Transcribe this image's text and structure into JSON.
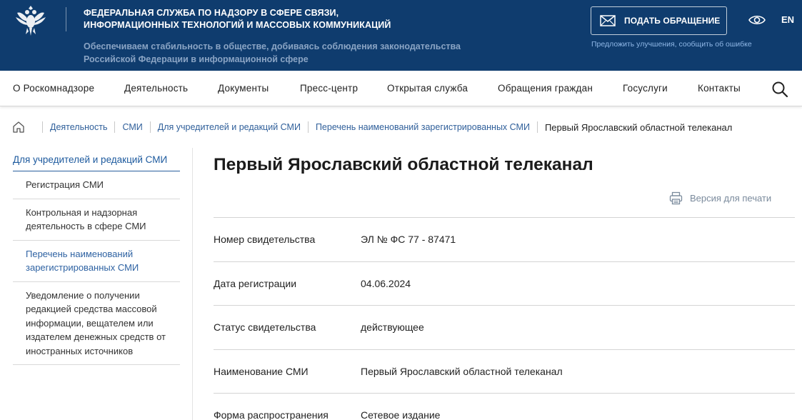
{
  "header": {
    "agency_line1": "ФЕДЕРАЛЬНАЯ СЛУЖБА ПО НАДЗОРУ В СФЕРЕ СВЯЗИ,",
    "agency_line2": "ИНФОРМАЦИОННЫХ ТЕХНОЛОГИЙ И МАССОВЫХ КОММУНИКАЦИЙ",
    "tagline_line1": "Обеспечиваем стабильность в обществе, добиваясь соблюдения законодательства",
    "tagline_line2": "Российской Федерации в информационной сфере",
    "appeal_button": "ПОДАТЬ ОБРАЩЕНИЕ",
    "feedback_link": "Предложить улучшения, сообщить об ошибке",
    "lang": "EN",
    "icons": [
      "emblem-icon",
      "mail-icon",
      "eye-icon"
    ],
    "background_color": "#0f3c6e"
  },
  "nav": {
    "items": [
      "О Роскомнадзоре",
      "Деятельность",
      "Документы",
      "Пресс-центр",
      "Открытая служба",
      "Обращения граждан",
      "Госуслуги",
      "Контакты"
    ],
    "search_icon": "search-icon"
  },
  "breadcrumb": {
    "home_icon": "home-icon",
    "links": [
      "Деятельность",
      "СМИ",
      "Для учредителей и редакций СМИ",
      "Перечень наименований зарегистрированных СМИ"
    ],
    "current": "Первый Ярославский областной телеканал"
  },
  "sidebar": {
    "title": "Для учредителей и редакций СМИ",
    "items": [
      {
        "label": "Регистрация СМИ",
        "active": false
      },
      {
        "label": "Контрольная и надзорная деятельность в сфере СМИ",
        "active": false
      },
      {
        "label": "Перечень наименований зарегистрированных СМИ",
        "active": true
      },
      {
        "label": "Уведомление о получении редакцией средства массовой информации, вещателем или издателем денежных средств от иностранных источников",
        "active": false
      }
    ]
  },
  "content": {
    "title": "Первый Ярославский областной телеканал",
    "print_label": "Версия для печати",
    "print_icon": "printer-icon",
    "rows": [
      {
        "label": "Номер свидетельства",
        "value": "ЭЛ № ФС 77 - 87471"
      },
      {
        "label": "Дата регистрации",
        "value": "04.06.2024"
      },
      {
        "label": "Статус свидетельства",
        "value": "действующее"
      },
      {
        "label": "Наименование СМИ",
        "value": "Первый Ярославский областной телеканал"
      },
      {
        "label": "Форма распространения",
        "value": "Сетевое издание"
      }
    ]
  },
  "colors": {
    "accent_link": "#2f5f9a",
    "active_sidebar": "#2f63a3",
    "tagline": "#8aa4c4"
  }
}
